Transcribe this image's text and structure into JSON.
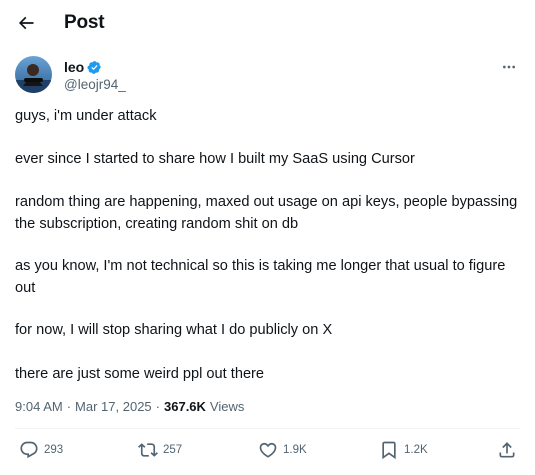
{
  "header": {
    "title": "Post",
    "back_icon": "arrow-left-icon"
  },
  "author": {
    "name": "leo",
    "handle": "@leojr94_",
    "verified_icon": "verified-badge-icon",
    "verified_color": "#1d9bf0",
    "more_icon": "more-horizontal-icon"
  },
  "tweet": {
    "paragraphs": [
      "guys, i'm under attack",
      "ever since I started to share how I built my SaaS using Cursor",
      "random thing are happening, maxed out usage on api keys, people bypassing the subscription, creating random shit on db",
      "as you know, I'm not technical so this is taking me longer that usual to figure out",
      "for now, I will stop sharing what I do publicly on X",
      "there are just some weird ppl out there"
    ]
  },
  "meta": {
    "time": "9:04 AM",
    "date": "Mar 17, 2025",
    "separator": "·",
    "views_count": "367.6K",
    "views_label": "Views"
  },
  "actions": {
    "reply": {
      "icon": "reply-icon",
      "count": "293"
    },
    "repost": {
      "icon": "repost-icon",
      "count": "257"
    },
    "like": {
      "icon": "heart-icon",
      "count": "1.9K"
    },
    "bookmark": {
      "icon": "bookmark-icon",
      "count": "1.2K"
    },
    "share": {
      "icon": "share-icon"
    }
  },
  "colors": {
    "text_primary": "#0f1419",
    "text_secondary": "#536471",
    "accent": "#1d9bf0",
    "divider": "#eff3f4"
  }
}
